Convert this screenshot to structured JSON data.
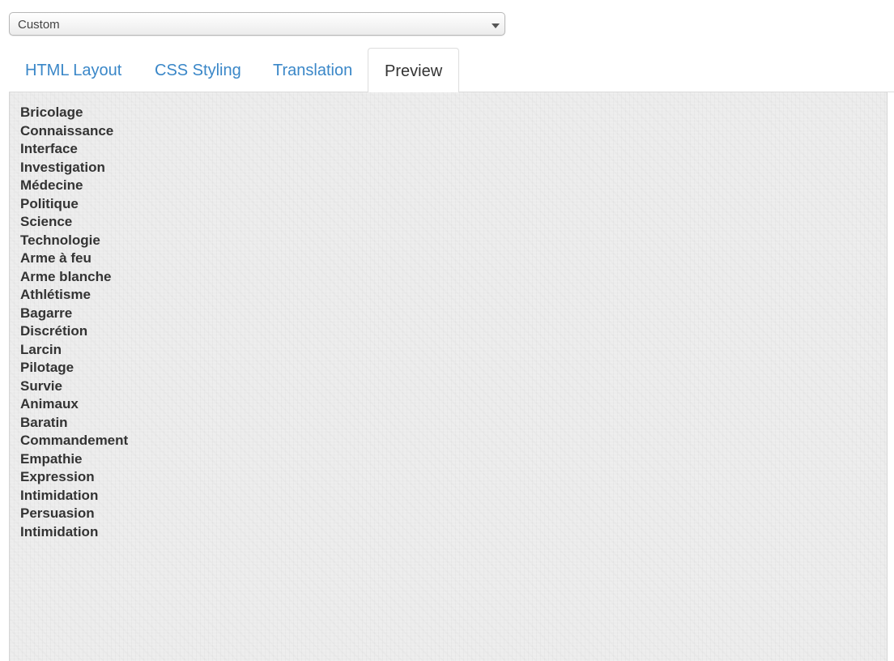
{
  "template_select": {
    "value": "Custom"
  },
  "tabs": [
    {
      "label": "HTML Layout",
      "active": false
    },
    {
      "label": "CSS Styling",
      "active": false
    },
    {
      "label": "Translation",
      "active": false
    },
    {
      "label": "Preview",
      "active": true
    }
  ],
  "preview": {
    "skills": [
      "Bricolage",
      "Connaissance",
      "Interface",
      "Investigation",
      "Médecine",
      "Politique",
      "Science",
      "Technologie",
      "Arme à feu",
      "Arme blanche",
      "Athlétisme",
      "Bagarre",
      "Discrétion",
      "Larcin",
      "Pilotage",
      "Survie",
      "Animaux",
      "Baratin",
      "Commandement",
      "Empathie",
      "Expression",
      "Intimidation",
      "Persuasion",
      "Intimidation"
    ]
  },
  "colors": {
    "tab_link": "#3a87c8",
    "tab_active_text": "#333333",
    "panel_bg": "#ececec",
    "skill_text": "#333333"
  }
}
